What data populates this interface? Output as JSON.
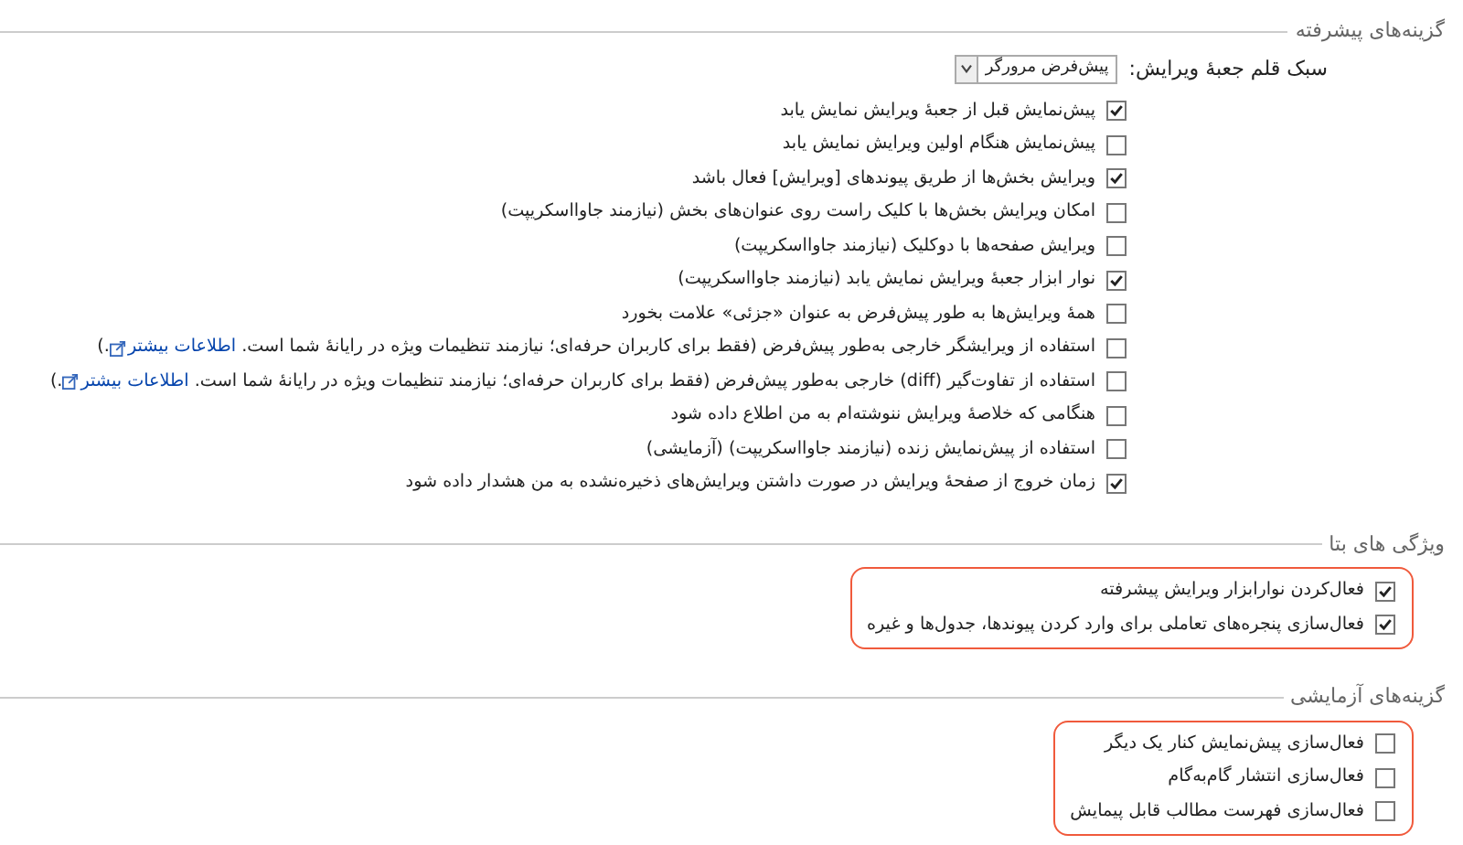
{
  "sections": [
    {
      "title": "گزینه‌های پیشرفته",
      "highlighted": false,
      "font_setting": {
        "label": "سبک قلم جعبهٔ ویرایش:",
        "value": "پیش‌فرض مرورگر"
      },
      "options": [
        {
          "label": "پیش‌نمایش قبل از جعبهٔ ویرایش نمایش یابد",
          "checked": true
        },
        {
          "label": "پیش‌نمایش هنگام اولین ویرایش نمایش یابد",
          "checked": false
        },
        {
          "label": "ویرایش بخش‌ها از طریق پیوندهای [ویرایش] فعال باشد",
          "checked": true
        },
        {
          "label": "امکان ویرایش بخش‌ها با کلیک راست روی عنوان‌های بخش (نیازمند جاوااسکریپت)",
          "checked": false
        },
        {
          "label": "ویرایش صفحه‌ها با دوکلیک (نیازمند جاوااسکریپت)",
          "checked": false
        },
        {
          "label": "نوار ابزار جعبهٔ ویرایش نمایش یابد (نیازمند جاوااسکریپت)",
          "checked": true
        },
        {
          "label": "همهٔ ویرایش‌ها به طور پیش‌فرض به عنوان «جزئی» علامت بخورد",
          "checked": false
        },
        {
          "label": "استفاده از ویرایشگر خارجی به‌طور پیش‌فرض (فقط برای کاربران حرفه‌ای؛ نیازمند تنظیمات ویژه در رایانهٔ شما است.",
          "link": "اطلاعات بیشتر",
          "suffix": ".)",
          "checked": false
        },
        {
          "label": "استفاده از تفاوت‌گیر (diff) خارجی به‌طور پیش‌فرض (فقط برای کاربران حرفه‌ای؛ نیازمند تنظیمات ویژه در رایانهٔ شما است.",
          "link": "اطلاعات بیشتر",
          "suffix": ".)",
          "checked": false
        },
        {
          "label": "هنگامی که خلاصهٔ ویرایش ننوشته‌ام به من اطلاع داده شود",
          "checked": false
        },
        {
          "label": "استفاده از پیش‌نمایش زنده (نیازمند جاوااسکریپت) (آزمایشی)",
          "checked": false
        },
        {
          "label": "زمان خروج از صفحهٔ ویرایش در صورت داشتن ویرایش‌های ذخیره‌نشده به من هشدار داده شود",
          "checked": true
        }
      ]
    },
    {
      "title": "ویژگی های بتا",
      "highlighted": true,
      "options": [
        {
          "label": "فعال‌کردن نوارابزار ویرایش پیشرفته",
          "checked": true
        },
        {
          "label": "فعال‌سازی پنجره‌های تعاملی برای وارد کردن پیوندها، جدول‌ها و غیره",
          "checked": true
        }
      ]
    },
    {
      "title": "گزینه‌های آزمایشی",
      "highlighted": true,
      "options": [
        {
          "label": "فعال‌سازی پیش‌نمایش کنار یک دیگر",
          "checked": false
        },
        {
          "label": "فعال‌سازی انتشار گام‌به‌گام",
          "checked": false
        },
        {
          "label": "فعال‌سازی فهرست مطالب قابل پیمایش",
          "checked": false
        }
      ]
    }
  ]
}
